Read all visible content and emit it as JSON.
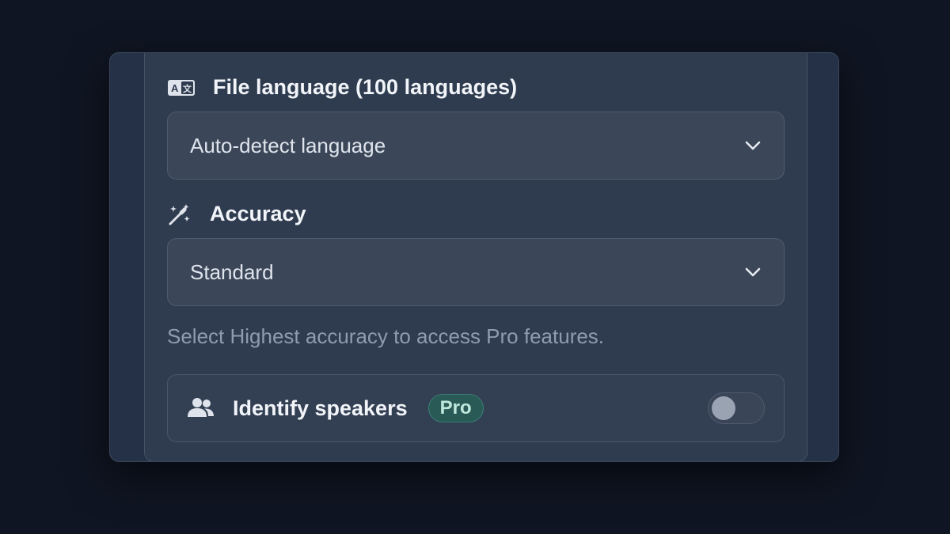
{
  "file_language": {
    "label": "File language (100 languages)",
    "icon": "translate-icon",
    "selected": "Auto-detect language"
  },
  "accuracy": {
    "label": "Accuracy",
    "icon": "magic-wand-icon",
    "selected": "Standard"
  },
  "hint": "Select Highest accuracy to access Pro features.",
  "identify_speakers": {
    "label": "Identify speakers",
    "icon": "users-icon",
    "badge": "Pro",
    "enabled": false
  },
  "colors": {
    "background": "#0f1522",
    "panel": "#2f3b4f",
    "badge_green": "#2a5a55"
  }
}
